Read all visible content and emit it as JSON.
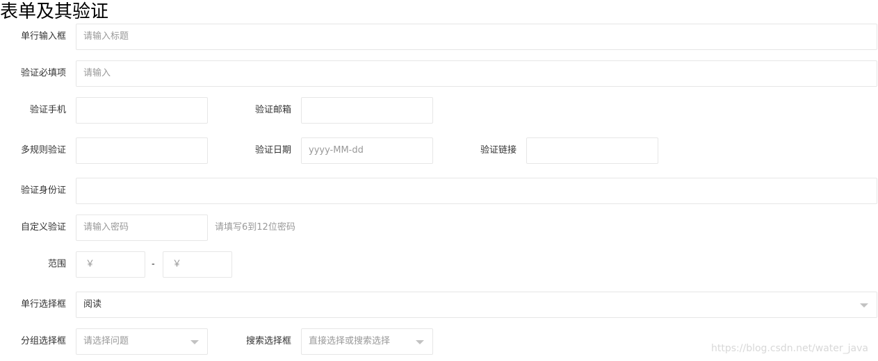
{
  "page": {
    "title": "表单及其验证",
    "watermark": "https://blog.csdn.net/water_java"
  },
  "form": {
    "title_input": {
      "label": "单行输入框",
      "placeholder": "请输入标题"
    },
    "required_input": {
      "label": "验证必填项",
      "placeholder": "请输入"
    },
    "phone_input": {
      "label": "验证手机",
      "value": ""
    },
    "email_input": {
      "label": "验证邮箱",
      "value": ""
    },
    "multi_rule_input": {
      "label": "多规则验证",
      "value": ""
    },
    "date_input": {
      "label": "验证日期",
      "placeholder": "yyyy-MM-dd"
    },
    "url_input": {
      "label": "验证链接",
      "value": ""
    },
    "id_card_input": {
      "label": "验证身份证",
      "value": ""
    },
    "password_input": {
      "label": "自定义验证",
      "placeholder": "请输入密码",
      "hint": "请填写6到12位密码"
    },
    "range": {
      "label": "范围",
      "min_placeholder": "￥",
      "max_placeholder": "￥",
      "separator": "-"
    },
    "single_select": {
      "label": "单行选择框",
      "value": "阅读"
    },
    "group_select": {
      "label": "分组选择框",
      "placeholder": "请选择问题"
    },
    "search_select": {
      "label": "搜索选择框",
      "placeholder": "直接选择或搜索选择"
    }
  },
  "icons": {
    "dropdown": "triangle-down-icon"
  },
  "colors": {
    "border": "#e6e6e6",
    "placeholder": "#999999",
    "text": "#333333"
  }
}
